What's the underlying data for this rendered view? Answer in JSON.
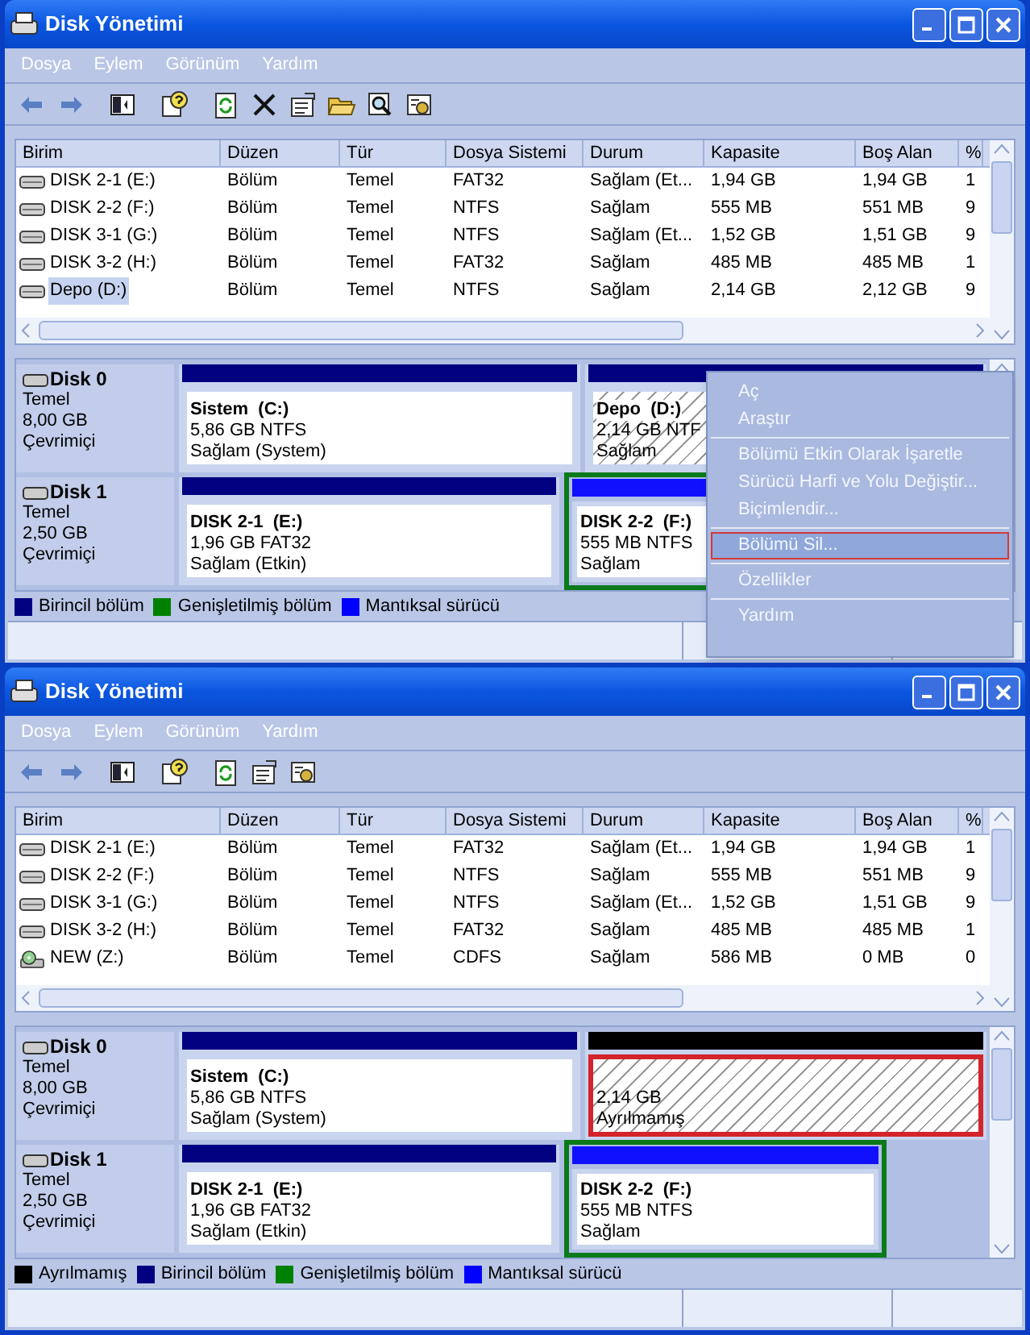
{
  "windows": [
    {
      "title": "Disk Yönetimi",
      "menu": [
        "Dosya",
        "Eylem",
        "Görünüm",
        "Yardım"
      ],
      "toolbar": [
        [
          {
            "kind": "back"
          },
          {
            "kind": "forward"
          }
        ],
        [
          {
            "kind": "tree"
          }
        ],
        [
          {
            "kind": "help"
          }
        ],
        [
          {
            "kind": "refresh"
          },
          {
            "kind": "delete"
          },
          {
            "kind": "properties"
          },
          {
            "kind": "open"
          },
          {
            "kind": "search"
          },
          {
            "kind": "settings"
          }
        ]
      ],
      "table": {
        "columns": [
          "Birim",
          "Düzen",
          "Tür",
          "Dosya Sistemi",
          "Durum",
          "Kapasite",
          "Boş Alan",
          "%"
        ],
        "rows": [
          {
            "kind": "drive",
            "selected": false,
            "cells": [
              "DISK 2-1 (E:)",
              "Bölüm",
              "Temel",
              "FAT32",
              "Sağlam (Et...",
              "1,94 GB",
              "1,94 GB",
              "1"
            ]
          },
          {
            "kind": "drive",
            "selected": false,
            "cells": [
              "DISK 2-2 (F:)",
              "Bölüm",
              "Temel",
              "NTFS",
              "Sağlam",
              "555 MB",
              "551 MB",
              "9"
            ]
          },
          {
            "kind": "drive",
            "selected": false,
            "cells": [
              "DISK 3-1 (G:)",
              "Bölüm",
              "Temel",
              "NTFS",
              "Sağlam (Et...",
              "1,52 GB",
              "1,51 GB",
              "9"
            ]
          },
          {
            "kind": "drive",
            "selected": false,
            "cells": [
              "DISK 3-2 (H:)",
              "Bölüm",
              "Temel",
              "FAT32",
              "Sağlam",
              "485 MB",
              "485 MB",
              "1"
            ]
          },
          {
            "kind": "drive",
            "selected": true,
            "cells": [
              "Depo (D:)",
              "Bölüm",
              "Temel",
              "NTFS",
              "Sağlam",
              "2,14 GB",
              "2,12 GB",
              "9"
            ]
          }
        ]
      },
      "disks": [
        {
          "name": "Disk 0",
          "type": "Temel",
          "size": "8,00 GB",
          "state": "Çevrimiçi",
          "partitions": [
            {
              "kind": "primary",
              "name": "Sistem  (C:)",
              "size": "5,86 GB NTFS",
              "status": "Sağlam (System)",
              "selected": false,
              "marked": false
            },
            {
              "kind": "primary",
              "name": "Depo  (D:)",
              "size": "2,14 GB NTF",
              "status": "Sağlam",
              "selected": true,
              "marked": false
            }
          ]
        },
        {
          "name": "Disk 1",
          "type": "Temel",
          "size": "2,50 GB",
          "state": "Çevrimiçi",
          "partitions": [
            {
              "kind": "primary",
              "name": "DISK 2-1  (E:)",
              "size": "1,96 GB FAT32",
              "status": "Sağlam (Etkin)",
              "selected": false,
              "marked": false
            },
            {
              "kind": "logical",
              "name": "DISK 2-2  (F:)",
              "size": "555 MB NTFS",
              "status": "Sağlam",
              "selected": false,
              "marked": false
            }
          ]
        }
      ],
      "legend": [
        {
          "label": "Birincil bölüm",
          "color": "#000080"
        },
        {
          "label": "Genişletilmiş bölüm",
          "color": "#008000"
        },
        {
          "label": "Mantıksal sürücü",
          "color": "#0000ff"
        }
      ],
      "context_menu": [
        [
          {
            "label": "Aç",
            "selected": false
          },
          {
            "label": "Araştır",
            "selected": false
          }
        ],
        [
          {
            "label": "Bölümü Etkin Olarak İşaretle",
            "selected": false
          },
          {
            "label": "Sürücü Harfi ve Yolu Değiştir...",
            "selected": false
          },
          {
            "label": "Biçimlendir...",
            "selected": false
          }
        ],
        [
          {
            "label": "Bölümü Sil...",
            "selected": true
          }
        ],
        [
          {
            "label": "Özellikler",
            "selected": false
          }
        ],
        [
          {
            "label": "Yardım",
            "selected": false
          }
        ]
      ]
    },
    {
      "title": "Disk Yönetimi",
      "menu": [
        "Dosya",
        "Eylem",
        "Görünüm",
        "Yardım"
      ],
      "toolbar": [
        [
          {
            "kind": "back"
          },
          {
            "kind": "forward"
          }
        ],
        [
          {
            "kind": "tree"
          }
        ],
        [
          {
            "kind": "help"
          }
        ],
        [
          {
            "kind": "refresh"
          },
          {
            "kind": "properties"
          },
          {
            "kind": "settings"
          }
        ]
      ],
      "table": {
        "columns": [
          "Birim",
          "Düzen",
          "Tür",
          "Dosya Sistemi",
          "Durum",
          "Kapasite",
          "Boş Alan",
          "%"
        ],
        "rows": [
          {
            "kind": "drive",
            "selected": false,
            "cells": [
              "DISK 2-1 (E:)",
              "Bölüm",
              "Temel",
              "FAT32",
              "Sağlam (Et...",
              "1,94 GB",
              "1,94 GB",
              "1"
            ]
          },
          {
            "kind": "drive",
            "selected": false,
            "cells": [
              "DISK 2-2 (F:)",
              "Bölüm",
              "Temel",
              "NTFS",
              "Sağlam",
              "555 MB",
              "551 MB",
              "9"
            ]
          },
          {
            "kind": "drive",
            "selected": false,
            "cells": [
              "DISK 3-1 (G:)",
              "Bölüm",
              "Temel",
              "NTFS",
              "Sağlam (Et...",
              "1,52 GB",
              "1,51 GB",
              "9"
            ]
          },
          {
            "kind": "drive",
            "selected": false,
            "cells": [
              "DISK 3-2 (H:)",
              "Bölüm",
              "Temel",
              "FAT32",
              "Sağlam",
              "485 MB",
              "485 MB",
              "1"
            ]
          },
          {
            "kind": "cd",
            "selected": false,
            "cells": [
              "NEW (Z:)",
              "Bölüm",
              "Temel",
              "CDFS",
              "Sağlam",
              "586 MB",
              "0 MB",
              "0"
            ]
          }
        ]
      },
      "disks": [
        {
          "name": "Disk 0",
          "type": "Temel",
          "size": "8,00 GB",
          "state": "Çevrimiçi",
          "partitions": [
            {
              "kind": "primary",
              "name": "Sistem  (C:)",
              "size": "5,86 GB NTFS",
              "status": "Sağlam (System)",
              "selected": false,
              "marked": false
            },
            {
              "kind": "unallocated",
              "size": "2,14 GB",
              "status": "Ayrılmamış",
              "selected": true,
              "marked": true
            }
          ]
        },
        {
          "name": "Disk 1",
          "type": "Temel",
          "size": "2,50 GB",
          "state": "Çevrimiçi",
          "partitions": [
            {
              "kind": "primary",
              "name": "DISK 2-1  (E:)",
              "size": "1,96 GB FAT32",
              "status": "Sağlam (Etkin)",
              "selected": false,
              "marked": false
            },
            {
              "kind": "logical",
              "name": "DISK 2-2  (F:)",
              "size": "555 MB NTFS",
              "status": "Sağlam",
              "selected": false,
              "marked": false
            }
          ]
        }
      ],
      "legend": [
        {
          "label": "Ayrılmamış",
          "color": "#000000"
        },
        {
          "label": "Birincil bölüm",
          "color": "#000080"
        },
        {
          "label": "Genişletilmiş bölüm",
          "color": "#008000"
        },
        {
          "label": "Mantıksal sürücü",
          "color": "#0000ff"
        }
      ]
    }
  ]
}
